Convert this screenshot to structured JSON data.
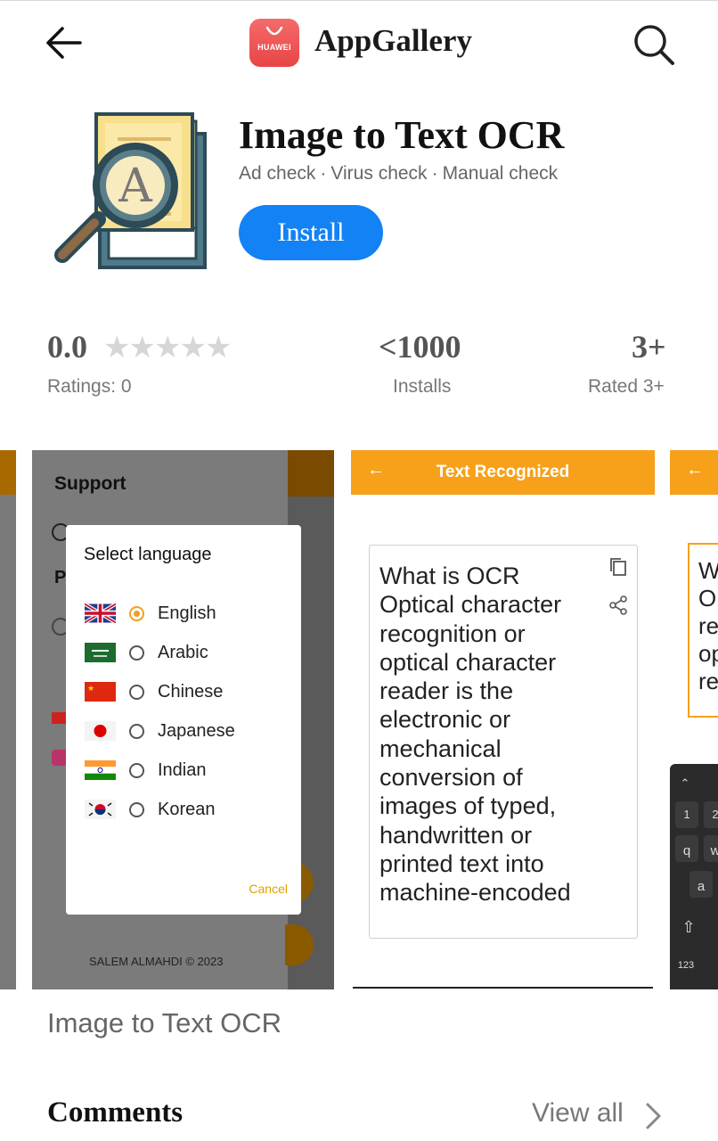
{
  "header": {
    "back_icon": "back-arrow-icon",
    "brand_logo_text": "HUAWEI",
    "brand_name": "AppGallery",
    "search_icon": "search-icon"
  },
  "app": {
    "title": "Image to Text OCR",
    "checks": [
      "Ad check",
      "Virus check",
      "Manual check"
    ],
    "install_label": "Install",
    "icon": "ocr-magnifier-document-icon"
  },
  "stats": {
    "rating_value": "0.0",
    "rating_label": "Ratings: 0",
    "stars_filled": 0,
    "stars_total": 5,
    "installs_value": "<1000",
    "installs_label": "Installs",
    "age_value": "3+",
    "age_label": "Rated 3+"
  },
  "screenshots": {
    "shot1": {
      "heading": "Support",
      "heading_partial": "P",
      "footer": "SALEM ALMAHDI © 2023",
      "dialog": {
        "title": "Select language",
        "languages": [
          {
            "label": "English",
            "selected": true,
            "flag": "uk-flag"
          },
          {
            "label": "Arabic",
            "selected": false,
            "flag": "saudi-flag"
          },
          {
            "label": "Chinese",
            "selected": false,
            "flag": "china-flag"
          },
          {
            "label": "Japanese",
            "selected": false,
            "flag": "japan-flag"
          },
          {
            "label": "Indian",
            "selected": false,
            "flag": "india-flag"
          },
          {
            "label": "Korean",
            "selected": false,
            "flag": "korea-flag"
          }
        ],
        "cancel_label": "Cancel"
      }
    },
    "shot2": {
      "back_arrow": "←",
      "title": "Text Recognized",
      "text": "What is OCR Optical character recognition or optical character reader is the electronic or mechanical conversion of images of typed, handwritten or printed text into machine-encoded"
    },
    "shot3": {
      "back_arrow": "←",
      "text_partial": "W\nO\nre\nop\nre",
      "keys": [
        "1",
        "2",
        "%",
        "q",
        "w",
        "@",
        "a",
        "123"
      ]
    }
  },
  "caption": "Image to Text OCR",
  "comments": {
    "title": "Comments",
    "view_all": "View all"
  }
}
